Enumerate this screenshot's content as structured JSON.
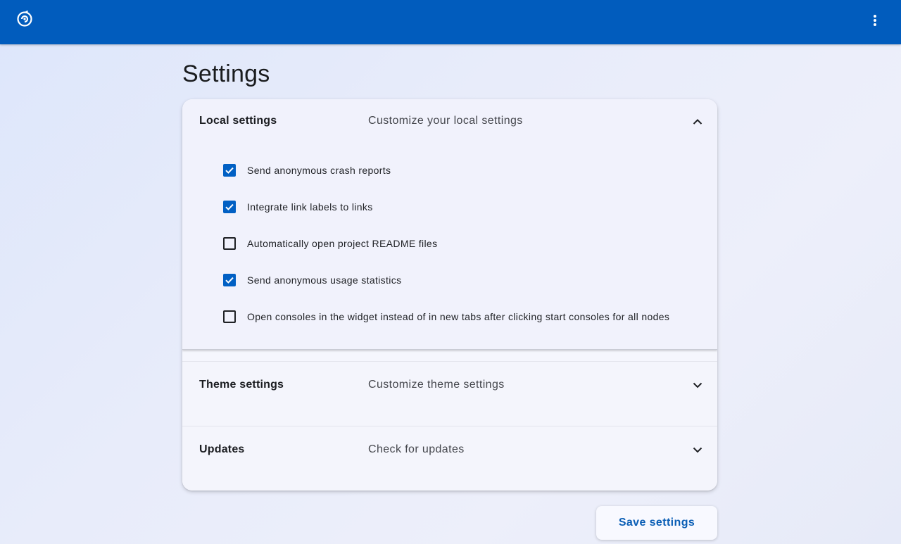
{
  "topbar": {
    "logo_icon": "app-logo-icon",
    "menu_icon": "more-vert-icon",
    "background_color": "#015cbd"
  },
  "page": {
    "title": "Settings"
  },
  "panels": [
    {
      "title": "Local settings",
      "description": "Customize your local settings",
      "expanded": true,
      "chevron_icon": "chevron-up-icon",
      "options": [
        {
          "label": "Send anonymous crash reports",
          "checked": true
        },
        {
          "label": "Integrate link labels to links",
          "checked": true
        },
        {
          "label": "Automatically open project README files",
          "checked": false
        },
        {
          "label": "Send anonymous usage statistics",
          "checked": true
        },
        {
          "label": "Open consoles in the widget instead of in new tabs after clicking start consoles for all nodes",
          "checked": false
        }
      ]
    },
    {
      "title": "Theme settings",
      "description": "Customize theme settings",
      "expanded": false,
      "chevron_icon": "chevron-down-icon"
    },
    {
      "title": "Updates",
      "description": "Check for updates",
      "expanded": false,
      "chevron_icon": "chevron-down-icon"
    }
  ],
  "actions": {
    "save_label": "Save settings"
  },
  "colors": {
    "accent": "#0160c4",
    "checkbox_checked": "#0160c4"
  }
}
